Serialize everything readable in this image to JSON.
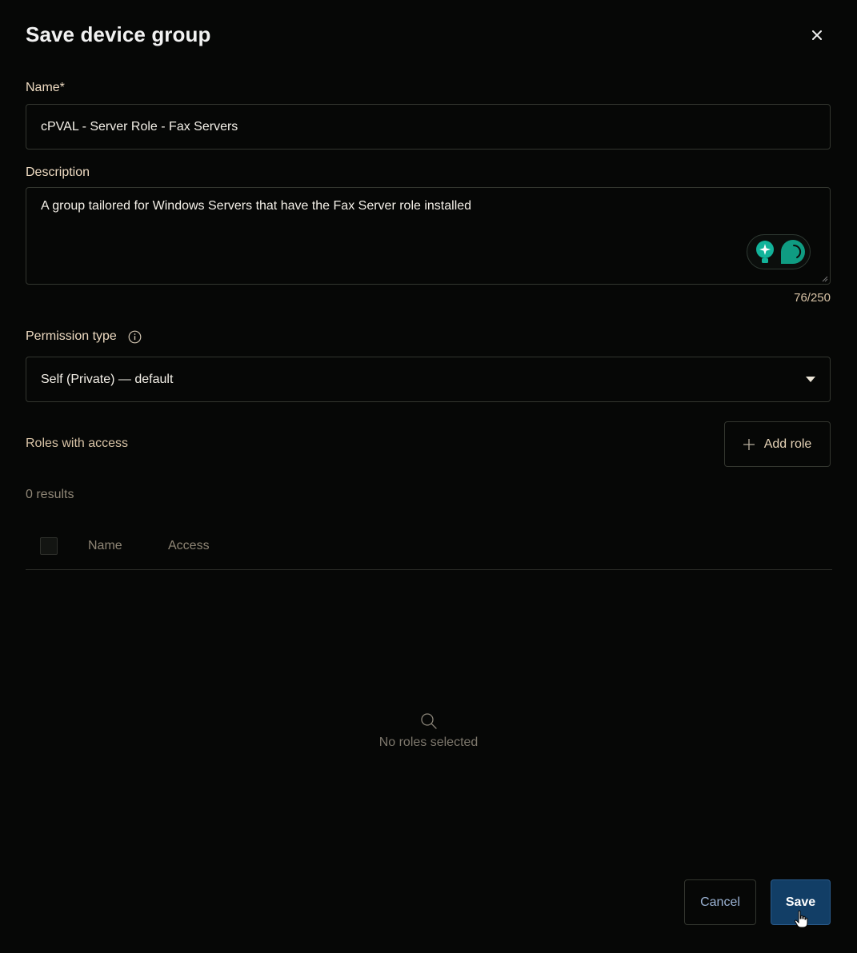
{
  "dialog": {
    "title": "Save device group",
    "close_icon": "close-icon"
  },
  "name_field": {
    "label": "Name*",
    "value": "cPVAL - Server Role - Fax Servers"
  },
  "description_field": {
    "label": "Description",
    "value": "A group tailored for Windows Servers that have the Fax Server role installed",
    "counter": "76/250"
  },
  "permission_field": {
    "label": "Permission type",
    "info_icon": "info-icon",
    "selected": "Self (Private) — default",
    "dropdown_icon": "caret-down-icon"
  },
  "roles": {
    "label": "Roles with access",
    "add_button_label": "Add role",
    "results_text": "0 results",
    "columns": [
      "Name",
      "Access"
    ],
    "empty_text": "No roles selected"
  },
  "footer": {
    "cancel_label": "Cancel",
    "save_label": "Save"
  },
  "colors": {
    "background": "#060706",
    "primary": "#123e66",
    "accent_teal": "#12b39a"
  }
}
